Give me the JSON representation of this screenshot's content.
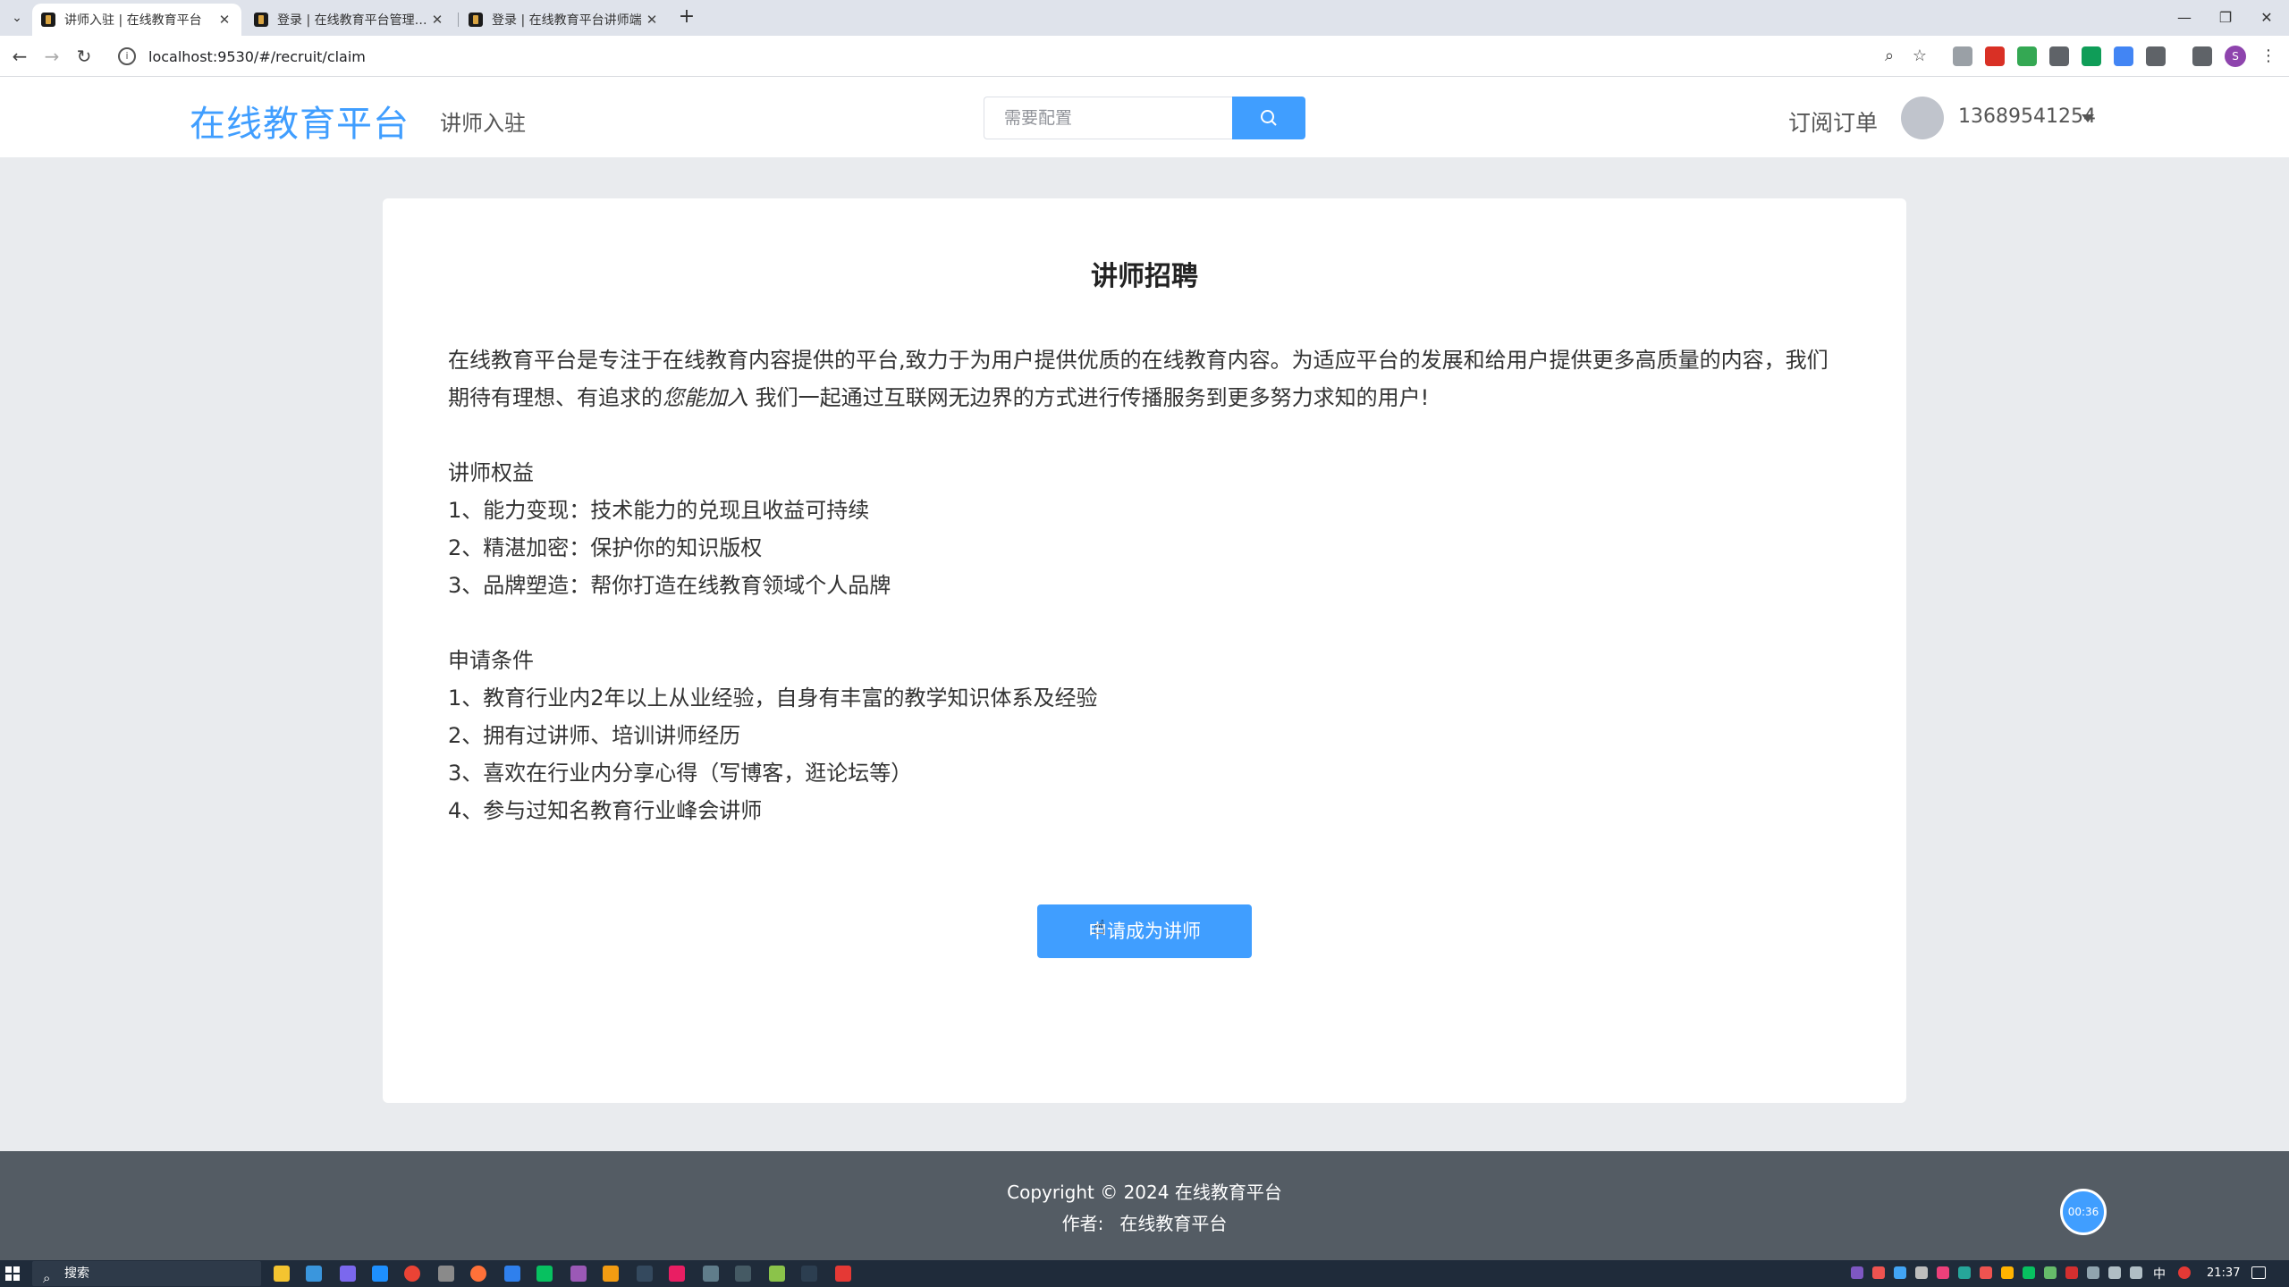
{
  "browser": {
    "tabs": [
      {
        "title": "讲师入驻 | 在线教育平台",
        "active": true
      },
      {
        "title": "登录 | 在线教育平台管理员端",
        "active": false
      },
      {
        "title": "登录 | 在线教育平台讲师端",
        "active": false
      }
    ],
    "url": "localhost:9530/#/recruit/claim",
    "profile_initial": "S"
  },
  "header": {
    "logo": "在线教育平台",
    "nav_recruit": "讲师入驻",
    "search_placeholder": "需要配置",
    "orders": "订阅订单",
    "username": "13689541254"
  },
  "main": {
    "title": "讲师招聘",
    "intro_part1": "在线教育平台是专注于在线教育内容提供的平台,致力于为用户提供优质的在线教育内容。为适应平台的发展和给用户提供更多高质量的内容，我们期待有理想、有追求的",
    "intro_emphasis": "您能加入",
    "intro_part2": " 我们一起通过互联网无边界的方式进行传播服务到更多努力求知的用户!",
    "benefits": {
      "heading": "讲师权益",
      "items": [
        "1、能力变现：技术能力的兑现且收益可持续",
        "2、精湛加密：保护你的知识版权",
        "3、品牌塑造：帮你打造在线教育领域个人品牌"
      ]
    },
    "requirements": {
      "heading": "申请条件",
      "items": [
        "1、教育行业内2年以上从业经验，自身有丰富的教学知识体系及经验",
        "2、拥有过讲师、培训讲师经历",
        "3、喜欢在行业内分享心得（写博客，逛论坛等）",
        "4、参与过知名教育行业峰会讲师"
      ]
    },
    "apply_button": "申请成为讲师"
  },
  "footer": {
    "copyright": "Copyright © 2024 在线教育平台",
    "author_label": "作者:",
    "author_value": "在线教育平台",
    "timer": "00:36"
  },
  "taskbar": {
    "search_label": "搜索",
    "ime": "中",
    "clock": "21:37"
  },
  "colors": {
    "accent": "#409eff",
    "footer_bg": "#545c64",
    "page_bg": "#e9ebee"
  }
}
